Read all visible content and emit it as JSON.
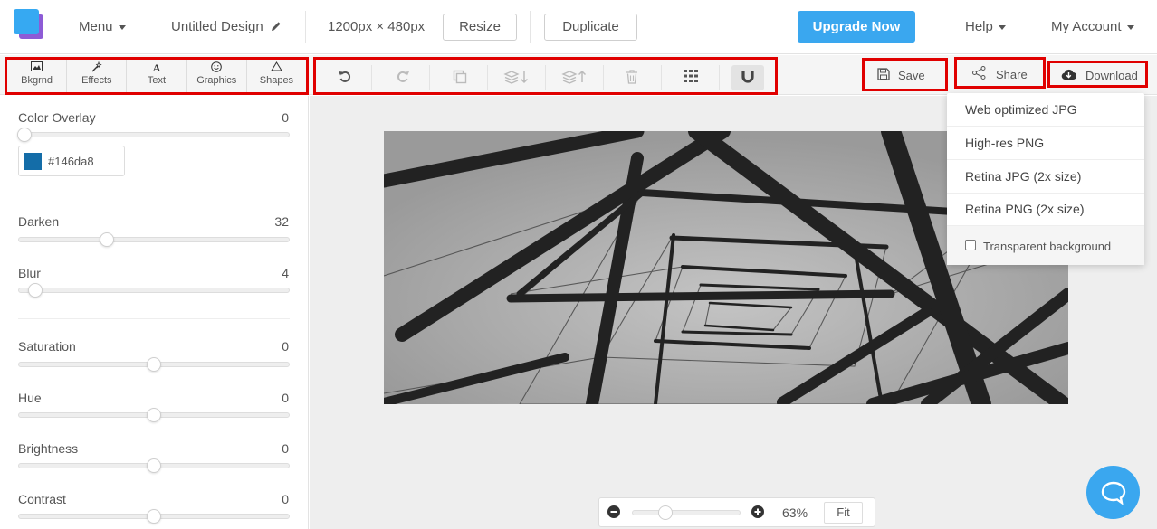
{
  "header": {
    "menu_label": "Menu",
    "design_title": "Untitled Design",
    "dimensions": "1200px × 480px",
    "resize_label": "Resize",
    "duplicate_label": "Duplicate",
    "upgrade_label": "Upgrade Now",
    "help_label": "Help",
    "account_label": "My Account"
  },
  "tabs": [
    {
      "label": "Bkgrnd",
      "icon": "image-icon"
    },
    {
      "label": "Effects",
      "icon": "magic-wand-icon"
    },
    {
      "label": "Text",
      "icon": "text-icon"
    },
    {
      "label": "Graphics",
      "icon": "smiley-icon"
    },
    {
      "label": "Shapes",
      "icon": "triangle-icon"
    }
  ],
  "toolbar": {
    "tools": [
      "undo-icon",
      "redo-icon",
      "copy-icon",
      "send-backward-icon",
      "bring-forward-icon",
      "trash-icon",
      "grid-icon",
      "magnet-icon"
    ],
    "save_label": "Save",
    "share_label": "Share",
    "download_label": "Download"
  },
  "effects": {
    "color_overlay": {
      "label": "Color Overlay",
      "value": "0",
      "color_hex": "#146da8"
    },
    "darken": {
      "label": "Darken",
      "value": "32"
    },
    "blur": {
      "label": "Blur",
      "value": "4"
    },
    "saturation": {
      "label": "Saturation",
      "value": "0"
    },
    "hue": {
      "label": "Hue",
      "value": "0"
    },
    "brightness": {
      "label": "Brightness",
      "value": "0"
    },
    "contrast": {
      "label": "Contrast",
      "value": "0"
    }
  },
  "download_menu": {
    "items": [
      "Web optimized JPG",
      "High-res PNG",
      "Retina JPG (2x size)",
      "Retina PNG (2x size)"
    ],
    "transparent_label": "Transparent background"
  },
  "zoom": {
    "percent": "63%",
    "fit_label": "Fit"
  },
  "colors": {
    "accent": "#3aa7ef",
    "highlight": "#e00000",
    "overlay": "#146da8"
  }
}
